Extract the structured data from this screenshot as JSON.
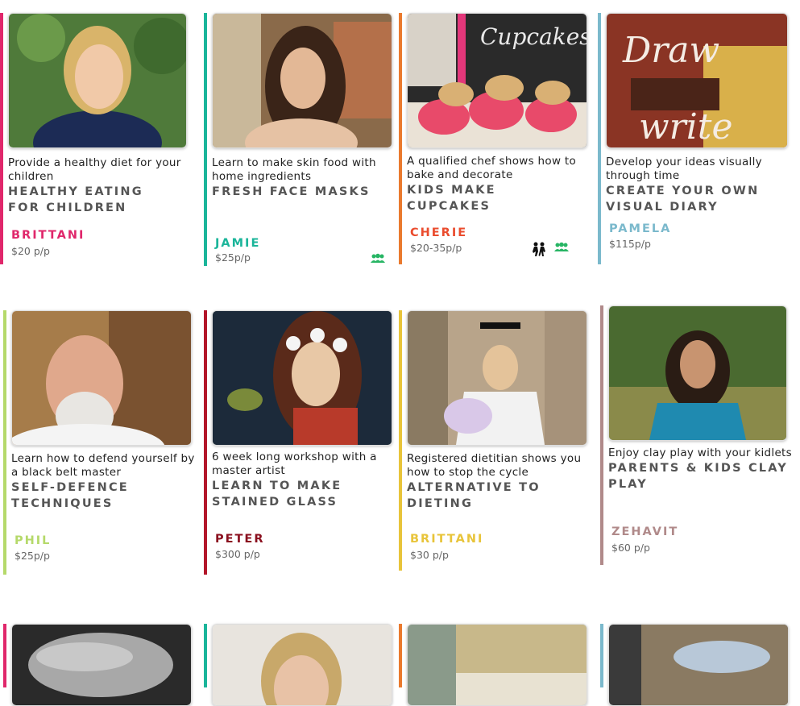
{
  "colors": {
    "pink": "#e0276b",
    "teal": "#1bb59a",
    "orange": "#ea7a2e",
    "lightblue": "#7bb9cc",
    "lime": "#b5d96a",
    "red": "#b3162a",
    "yellow": "#e8c43a",
    "mauve": "#b08a8a",
    "group_icon": "#27b564"
  },
  "rows": [
    {
      "cards": [
        {
          "desc": "Provide a healthy diet for your children",
          "title": "HEALTHY EATING FOR CHILDREN",
          "host": "BRITTANI",
          "price": "$20 p/p",
          "accent": "#e0276b",
          "host_color": "#e0276b",
          "icons": []
        },
        {
          "desc": "Learn to make skin food with home ingredients",
          "title": "FRESH FACE MASKS",
          "host": "JAMIE",
          "price": "$25p/p",
          "accent": "#1bb59a",
          "host_color": "#1bb59a",
          "icons": [
            "group-icon"
          ]
        },
        {
          "desc": "A qualified chef shows how to bake and decorate",
          "title": "KIDS MAKE CUPCAKES",
          "host": "CHERIE",
          "price": "$20-35p/p",
          "accent": "#ea7a2e",
          "host_color": "#ea4c2e",
          "icons": [
            "kids-icon",
            "group-icon"
          ]
        },
        {
          "desc": "Develop your ideas visually through time",
          "title": "CREATE YOUR OWN VISUAL DIARY",
          "host": "PAMELA",
          "price": "$115p/p",
          "accent": "#7bb9cc",
          "host_color": "#7bb9cc",
          "icons": []
        }
      ]
    },
    {
      "cards": [
        {
          "desc": "Learn how to defend yourself by a black belt master",
          "title": "SELF-DEFENCE TECHNIQUES",
          "host": "PHIL",
          "price": "$25p/p",
          "accent": "#b5d96a",
          "host_color": "#b5d96a",
          "icons": []
        },
        {
          "desc": "6 week long workshop with a master artist",
          "title": "LEARN TO MAKE STAINED GLASS",
          "host": "PETER",
          "price": "$300 p/p",
          "accent": "#b3162a",
          "host_color": "#8a0f1e",
          "icons": []
        },
        {
          "desc": "Registered dietitian shows you how to stop the cycle",
          "title": "ALTERNATIVE TO DIETING",
          "host": "BRITTANI",
          "price": "$30 p/p",
          "accent": "#e8c43a",
          "host_color": "#e8c43a",
          "icons": []
        },
        {
          "desc": "Enjoy clay play with your kidlets",
          "title": "PARENTS & KIDS CLAY PLAY",
          "host": "ZEHAVIT",
          "price": "$60 p/p",
          "accent": "#b08a8a",
          "host_color": "#b08a8a",
          "icons": []
        }
      ]
    }
  ]
}
